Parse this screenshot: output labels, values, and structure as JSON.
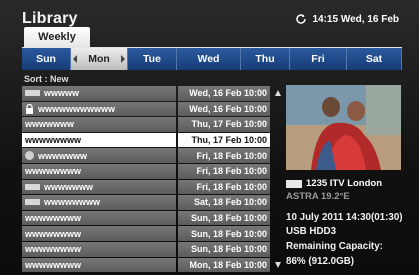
{
  "header": {
    "title": "Library",
    "clock_text": "14:15 Wed, 16 Feb"
  },
  "tabs": {
    "active_label": "Weekly"
  },
  "days": [
    {
      "label": "Sun",
      "selected": false
    },
    {
      "label": "Mon",
      "selected": true
    },
    {
      "label": "Tue",
      "selected": false
    },
    {
      "label": "Wed",
      "selected": false
    },
    {
      "label": "Thu",
      "selected": false
    },
    {
      "label": "Fri",
      "selected": false
    },
    {
      "label": "Sat",
      "selected": false
    }
  ],
  "sort_label": "Sort : New",
  "recordings": [
    {
      "icon": "record-icon",
      "name": "wwwww",
      "date": "Wed, 16 Feb 10:00",
      "selected": false
    },
    {
      "icon": "lock-icon",
      "name": "wwwwwwwwwww",
      "date": "Wed, 16 Feb 10:00",
      "selected": false
    },
    {
      "icon": "",
      "name": "wwwwwww",
      "date": "Thu, 17 Feb 10:00",
      "selected": false
    },
    {
      "icon": "",
      "name": "wwwwwwww",
      "date": "Thu, 17 Feb 10:00",
      "selected": true
    },
    {
      "icon": "dot-icon",
      "name": "wwwwwww",
      "date": "Fri, 18 Feb 10:00",
      "selected": false
    },
    {
      "icon": "",
      "name": "wwwwwwww",
      "date": "Fri, 18 Feb 10:00",
      "selected": false
    },
    {
      "icon": "record-icon",
      "name": "wwwwwww",
      "date": "Fri, 18 Feb 10:00",
      "selected": false
    },
    {
      "icon": "record-icon",
      "name": "wwwwwwww",
      "date": "Sat, 18 Feb 10:00",
      "selected": false
    },
    {
      "icon": "",
      "name": "wwwwwwww",
      "date": "Sun, 18 Feb 10:00",
      "selected": false
    },
    {
      "icon": "",
      "name": "wwwwwwww",
      "date": "Sun, 18 Feb 10:00",
      "selected": false
    },
    {
      "icon": "",
      "name": "wwwwwwww",
      "date": "Sun, 18 Feb 10:00",
      "selected": false
    },
    {
      "icon": "",
      "name": "wwwwwwww",
      "date": "Mon, 18 Feb 10:00",
      "selected": false
    }
  ],
  "detail": {
    "channel": "1235 ITV London",
    "satellite": "ASTRA 19.2°E",
    "datetime": "10 July 2011  14:30(01:30)",
    "storage": "USB HDD3",
    "capacity_label": "Remaining Capacity:",
    "capacity_value": "86% (912.0GB)"
  }
}
